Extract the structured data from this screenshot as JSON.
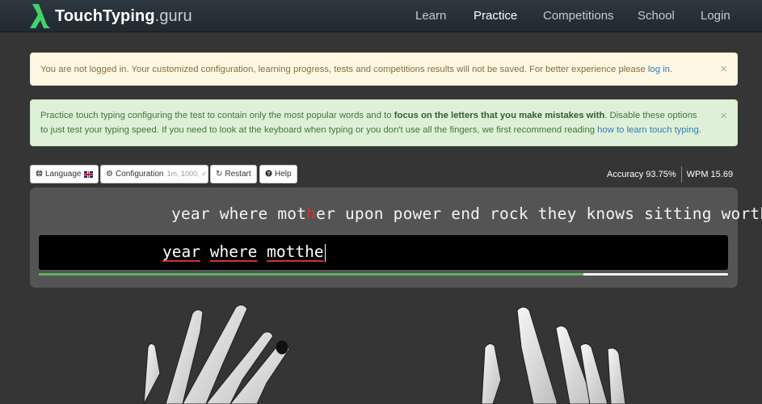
{
  "nav": {
    "brand": {
      "main": "TouchTyping",
      "suffix": ".guru"
    },
    "links": [
      "Learn",
      "Practice",
      "Competitions",
      "School",
      "Login"
    ],
    "active": "Practice"
  },
  "alerts": {
    "warning": {
      "text": "You are not logged in. Your customized configuration, learning progress, tests and competitions results will not be saved. For better experience please ",
      "link": "log in",
      "tail": ".",
      "close": "×"
    },
    "info": {
      "text1": "Practice touch typing configuring the test to contain only the most popular words and to ",
      "bold": "focus on the letters that you make mistakes with",
      "text2": ". Disable these options to just test your typing speed. If you need to look at the keyboard when typing or you don't use all the fingers, we first recommend reading ",
      "link": "how to learn touch typing",
      "tail": ".",
      "close": "×"
    }
  },
  "toolbar": {
    "language": "Language",
    "configuration": "Configuration",
    "configuration_hint": "1m, 1000, ✓",
    "restart": "Restart",
    "help": "Help"
  },
  "stats": {
    "accuracy": "Accuracy 93.75%",
    "wpm": "WPM 15.69"
  },
  "typing": {
    "target_before": "year where mot",
    "target_error": "h",
    "target_after": "er upon power end rock they knows sitting worth",
    "typed": [
      "year",
      "where",
      "motthe"
    ],
    "progress": 0.79
  },
  "colors": {
    "accent": "#5cb25c",
    "error": "#e2302b",
    "link": "#337ab7"
  }
}
